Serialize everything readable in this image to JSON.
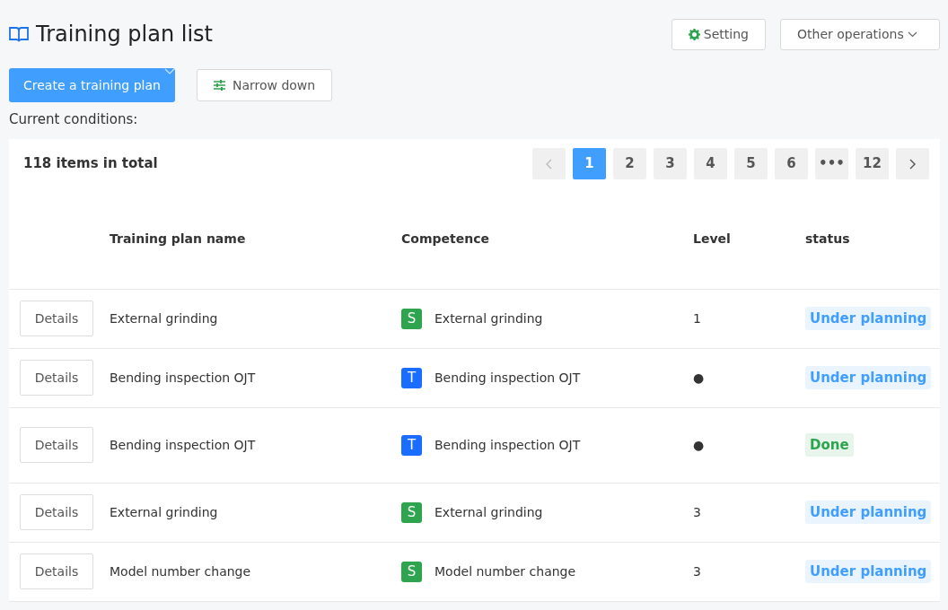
{
  "page": {
    "title": "Training plan list"
  },
  "top_buttons": [
    {
      "label": "Setting",
      "kind": "setting"
    },
    {
      "label": "Other operations",
      "kind": "dropdown"
    }
  ],
  "create_button": {
    "label": "Create a training plan"
  },
  "filter_button": {
    "label": "Narrow down"
  },
  "conditions_label": "Current conditions:",
  "total": "118 items in total",
  "pagination": {
    "prev_disabled": true,
    "next_disabled": false,
    "pages": [
      {
        "label": "1",
        "selected": true
      },
      {
        "label": "2",
        "selected": false
      },
      {
        "label": "3",
        "selected": false
      },
      {
        "label": "4",
        "selected": false
      },
      {
        "label": "5",
        "selected": false
      },
      {
        "label": "6",
        "selected": false
      },
      {
        "label": "•••",
        "selected": false
      },
      {
        "label": "12",
        "selected": false
      }
    ]
  },
  "table": {
    "columns": [
      "Training plan name",
      "Competence",
      "Level",
      "status"
    ],
    "rows": [
      {
        "action": "Details",
        "name": "External grinding",
        "competence": {
          "letter": "S",
          "color": "#2ea44f",
          "name": "External grinding"
        },
        "level": "1",
        "status": {
          "label": "Under planning",
          "color": "#409eff"
        },
        "tall": false
      },
      {
        "action": "Details",
        "name": "Bending inspection OJT",
        "competence": {
          "letter": "T",
          "color": "#1a6dff",
          "name": "Bending inspection OJT"
        },
        "level": "●",
        "status": {
          "label": "Under planning",
          "color": "#409eff"
        },
        "tall": false
      },
      {
        "action": "Details",
        "name": "Bending inspection OJT",
        "competence": {
          "letter": "T",
          "color": "#1a6dff",
          "name": "Bending inspection OJT"
        },
        "level": "●",
        "status": {
          "label": "Done",
          "color": "#2ea44f"
        },
        "tall": true
      },
      {
        "action": "Details",
        "name": "External grinding",
        "competence": {
          "letter": "S",
          "color": "#2ea44f",
          "name": "External grinding"
        },
        "level": "3",
        "status": {
          "label": "Under planning",
          "color": "#409eff"
        },
        "tall": false
      },
      {
        "action": "Details",
        "name": "Model number change",
        "competence": {
          "letter": "S",
          "color": "#2ea44f",
          "name": "Model number change"
        },
        "level": "3",
        "status": {
          "label": "Under planning",
          "color": "#409eff"
        },
        "tall": false
      }
    ]
  }
}
